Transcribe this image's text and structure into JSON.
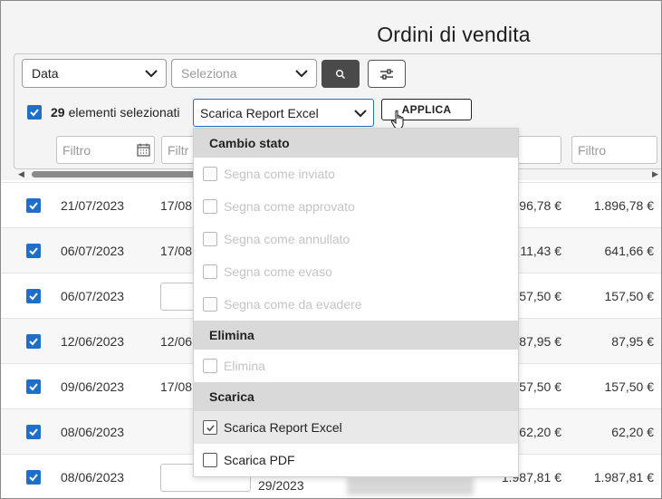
{
  "page": {
    "title": "Ordini di vendita"
  },
  "toolbar": {
    "sort_select": "Data",
    "filter_select_placeholder": "Seleziona"
  },
  "selection": {
    "count": "29",
    "label": "elementi selezionati",
    "action_select": "Scarica Report Excel",
    "apply_label": "APPLICA"
  },
  "filters": {
    "placeholder": "Filtro",
    "placeholder_short": "Filtr"
  },
  "rows": [
    {
      "date": "21/07/2023",
      "date2": "17/08",
      "amount1": "96,78 €",
      "amount2": "1.896,78 €"
    },
    {
      "date": "06/07/2023",
      "date2": "17/08",
      "amount1": "11,43 €",
      "amount2": "641,66 €"
    },
    {
      "date": "06/07/2023",
      "date2": "",
      "amount1": "57,50 €",
      "amount2": "157,50 €"
    },
    {
      "date": "12/06/2023",
      "date2": "12/06",
      "amount1": "87,95 €",
      "amount2": "87,95 €"
    },
    {
      "date": "09/06/2023",
      "date2": "17/08",
      "amount1": "57,50 €",
      "amount2": "157,50 €"
    },
    {
      "date": "08/06/2023",
      "date2": "",
      "amount1": "62,20 €",
      "amount2": "62,20 €"
    },
    {
      "date": "08/06/2023",
      "date2": "29/2023",
      "amount1": "1.987,81 €",
      "amount2": "1.987,81 €"
    }
  ],
  "dropdown": {
    "groups": [
      {
        "label": "Cambio stato",
        "items": [
          {
            "label": "Segna come inviato",
            "state": "disabled"
          },
          {
            "label": "Segna come approvato",
            "state": "disabled"
          },
          {
            "label": "Segna come annullato",
            "state": "disabled"
          },
          {
            "label": "Segna come evaso",
            "state": "disabled"
          },
          {
            "label": "Segna come da evadere",
            "state": "disabled"
          }
        ]
      },
      {
        "label": "Elimina",
        "items": [
          {
            "label": "Elimina",
            "state": "disabled"
          }
        ]
      },
      {
        "label": "Scarica",
        "items": [
          {
            "label": "Scarica Report Excel",
            "state": "selected"
          },
          {
            "label": "Scarica PDF",
            "state": "enabled"
          }
        ]
      }
    ]
  },
  "colors": {
    "accent": "#1e6fc9",
    "search_button": "#4a4a4a",
    "group_header": "#d9d9d9"
  },
  "icons": [
    "chevron-down-icon",
    "search-icon",
    "sliders-icon",
    "calendar-icon",
    "checkbox-checked-icon",
    "hand-cursor-icon"
  ]
}
